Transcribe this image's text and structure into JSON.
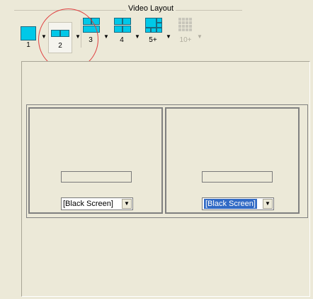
{
  "header": {
    "title": "Video Layout"
  },
  "toolbar": {
    "buttons": [
      {
        "label": "1",
        "icon": "layout-1-icon",
        "enabled": true,
        "active": false
      },
      {
        "label": "2",
        "icon": "layout-2-icon",
        "enabled": true,
        "active": true
      },
      {
        "label": "3",
        "icon": "layout-3-icon",
        "enabled": true,
        "active": false
      },
      {
        "label": "4",
        "icon": "layout-4-icon",
        "enabled": true,
        "active": false
      },
      {
        "label": "5+",
        "icon": "layout-5plus-icon",
        "enabled": true,
        "active": false
      },
      {
        "label": "10+",
        "icon": "layout-10plus-icon",
        "enabled": false,
        "active": false
      }
    ]
  },
  "cells": [
    {
      "source": "[Black Screen]",
      "selected": false
    },
    {
      "source": "[Black Screen]",
      "selected": true
    }
  ],
  "colors": {
    "accent": "#00c8e8",
    "highlight": "#316ac5",
    "annotation": "#e04040"
  }
}
